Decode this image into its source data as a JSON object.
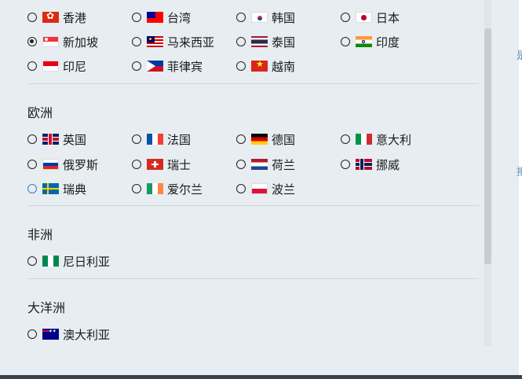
{
  "asia_rows": [
    [
      {
        "label": "香港",
        "flag": "hk"
      },
      {
        "label": "台湾",
        "flag": "tw"
      },
      {
        "label": "韩国",
        "flag": "kr"
      },
      {
        "label": "日本",
        "flag": "jp"
      }
    ],
    [
      {
        "label": "新加坡",
        "flag": "sg",
        "selected": true
      },
      {
        "label": "马来西亚",
        "flag": "my"
      },
      {
        "label": "泰国",
        "flag": "th"
      },
      {
        "label": "印度",
        "flag": "in"
      }
    ],
    [
      {
        "label": "印尼",
        "flag": "id"
      },
      {
        "label": "菲律宾",
        "flag": "ph"
      },
      {
        "label": "越南",
        "flag": "vn"
      }
    ]
  ],
  "sections": {
    "europe": {
      "title": "欧洲"
    },
    "africa": {
      "title": "非洲"
    },
    "oceania": {
      "title": "大洋洲"
    }
  },
  "europe_rows": [
    [
      {
        "label": "英国",
        "flag": "uk"
      },
      {
        "label": "法国",
        "flag": "fr"
      },
      {
        "label": "德国",
        "flag": "de"
      },
      {
        "label": "意大利",
        "flag": "it"
      }
    ],
    [
      {
        "label": "俄罗斯",
        "flag": "ru"
      },
      {
        "label": "瑞士",
        "flag": "ch"
      },
      {
        "label": "荷兰",
        "flag": "nl"
      },
      {
        "label": "挪威",
        "flag": "no"
      }
    ],
    [
      {
        "label": "瑞典",
        "flag": "se",
        "focused": true
      },
      {
        "label": "爱尔兰",
        "flag": "ie"
      },
      {
        "label": "波兰",
        "flag": "pl"
      }
    ]
  ],
  "africa_rows": [
    [
      {
        "label": "尼日利亚",
        "flag": "ng"
      }
    ]
  ],
  "oceania_rows": [
    [
      {
        "label": "澳大利亚",
        "flag": "au"
      }
    ]
  ],
  "edge_marks": [
    "是",
    "拒"
  ],
  "colors": {
    "background": "#e7edf1",
    "focus": "#2d7fd6",
    "divider": "#cfd7dc"
  }
}
